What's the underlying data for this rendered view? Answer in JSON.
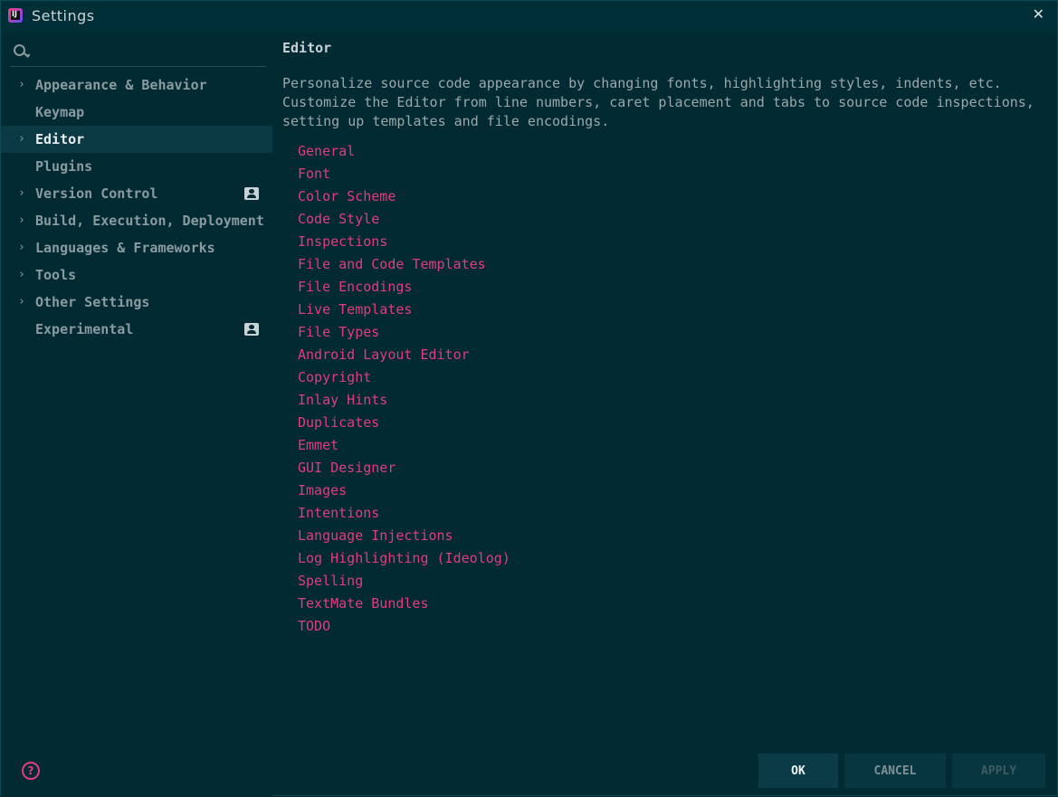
{
  "window": {
    "title": "Settings",
    "close_glyph": "✕",
    "app_icon_letter": "IJ"
  },
  "search": {
    "value": "",
    "placeholder": ""
  },
  "sidebar": {
    "items": [
      {
        "label": "Appearance & Behavior",
        "expandable": true
      },
      {
        "label": "Keymap",
        "expandable": false
      },
      {
        "label": "Editor",
        "expandable": true,
        "selected": true
      },
      {
        "label": "Plugins",
        "expandable": false
      },
      {
        "label": "Version Control",
        "expandable": true,
        "badge": "profile-icon"
      },
      {
        "label": "Build, Execution, Deployment",
        "expandable": true
      },
      {
        "label": "Languages & Frameworks",
        "expandable": true
      },
      {
        "label": "Tools",
        "expandable": true
      },
      {
        "label": "Other Settings",
        "expandable": true
      },
      {
        "label": "Experimental",
        "expandable": false,
        "badge": "profile-icon"
      }
    ]
  },
  "main": {
    "heading": "Editor",
    "description": "Personalize source code appearance by changing fonts, highlighting styles, indents, etc. Customize the Editor from line numbers, caret placement and tabs to source code inspections, setting up templates and file encodings.",
    "links": [
      "General",
      "Font",
      "Color Scheme",
      "Code Style",
      "Inspections",
      "File and Code Templates",
      "File Encodings",
      "Live Templates",
      "File Types",
      "Android Layout Editor",
      "Copyright",
      "Inlay Hints",
      "Duplicates",
      "Emmet",
      "GUI Designer",
      "Images",
      "Intentions",
      "Language Injections",
      "Log Highlighting (Ideolog)",
      "Spelling",
      "TextMate Bundles",
      "TODO"
    ]
  },
  "footer": {
    "help_glyph": "?",
    "ok_label": "OK",
    "cancel_label": "CANCEL",
    "apply_label": "APPLY"
  },
  "colors": {
    "background": "#022a33",
    "accent_link": "#e23c7e",
    "selected_row": "#0b3a44"
  }
}
